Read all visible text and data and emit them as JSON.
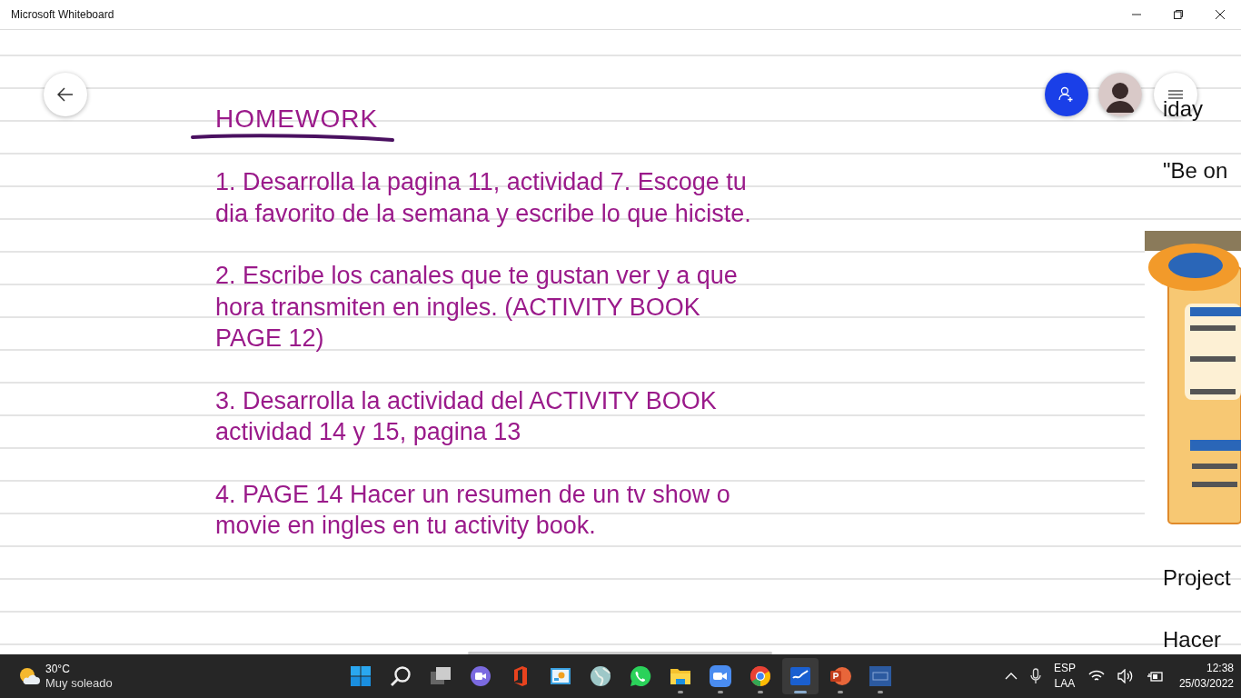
{
  "window": {
    "title": "Microsoft Whiteboard"
  },
  "board": {
    "heading": "HOMEWORK",
    "items": [
      {
        "lines": [
          "1. Desarrolla la pagina 11, actividad 7. Escoge tu",
          "dia favorito de la semana y escribe lo que hiciste."
        ]
      },
      {
        "lines": [
          "2. Escribe los canales que te gustan ver y a que",
          "hora transmiten en ingles.  (ACTIVITY BOOK",
          "PAGE 12)"
        ]
      },
      {
        "lines": [
          "3. Desarrolla la actividad del ACTIVITY BOOK",
          "actividad 14 y 15, pagina 13"
        ]
      },
      {
        "lines": [
          "4. PAGE 14 Hacer un resumen de un tv show o",
          "movie en ingles en tu activity book."
        ]
      }
    ],
    "side_notes": [
      "iday",
      "\"Be on",
      "Project",
      "Hacer"
    ]
  },
  "taskbar": {
    "weather": {
      "temp": "30°C",
      "condition": "Muy soleado"
    },
    "apps": [
      {
        "kind": "start",
        "running": false,
        "active": false
      },
      {
        "kind": "search",
        "running": false,
        "active": false
      },
      {
        "kind": "taskview",
        "running": false,
        "active": false
      },
      {
        "kind": "chat",
        "running": false,
        "active": false
      },
      {
        "kind": "office",
        "running": false,
        "active": false
      },
      {
        "kind": "photos",
        "running": false,
        "active": false
      },
      {
        "kind": "globe",
        "running": false,
        "active": false
      },
      {
        "kind": "whatsapp",
        "running": false,
        "active": false
      },
      {
        "kind": "folder",
        "running": true,
        "active": false
      },
      {
        "kind": "camera",
        "running": true,
        "active": false
      },
      {
        "kind": "chrome",
        "running": true,
        "active": false
      },
      {
        "kind": "whiteboard",
        "running": true,
        "active": true
      },
      {
        "kind": "powerpoint",
        "running": true,
        "active": false
      },
      {
        "kind": "plus",
        "running": true,
        "active": false
      }
    ],
    "tray": {
      "language": "ESP",
      "layout": "LAA",
      "time": "12:38",
      "date": "25/03/2022"
    }
  }
}
